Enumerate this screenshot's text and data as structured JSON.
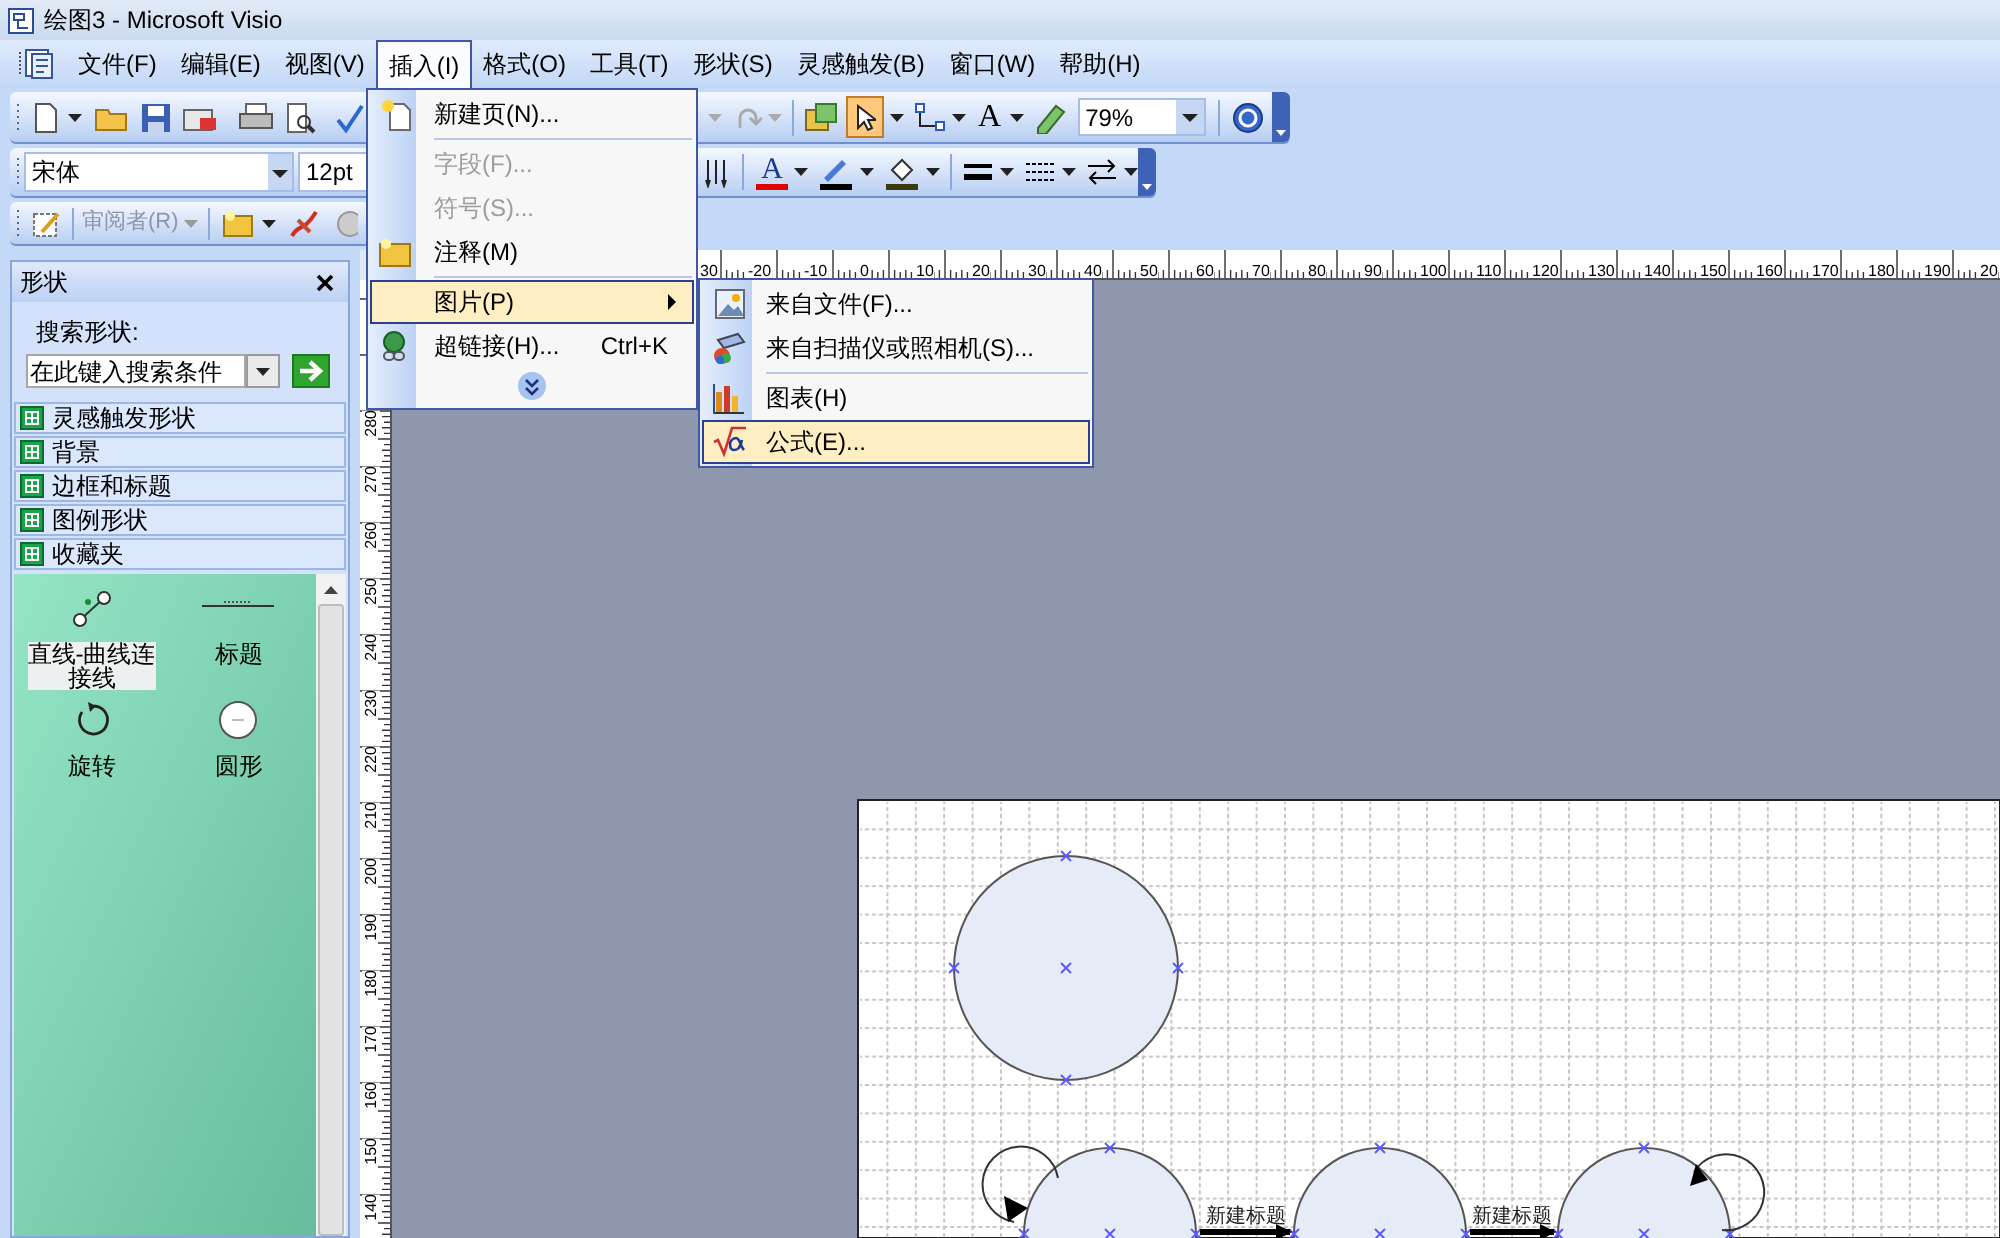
{
  "window": {
    "title": "绘图3 - Microsoft Visio"
  },
  "menu_bar": [
    {
      "label": "文件(F)",
      "selected": false
    },
    {
      "label": "编辑(E)",
      "selected": false
    },
    {
      "label": "视图(V)",
      "selected": false
    },
    {
      "label": "插入(I)",
      "selected": true
    },
    {
      "label": "格式(O)",
      "selected": false
    },
    {
      "label": "工具(T)",
      "selected": false
    },
    {
      "label": "形状(S)",
      "selected": false
    },
    {
      "label": "灵感触发(B)",
      "selected": false
    },
    {
      "label": "窗口(W)",
      "selected": false
    },
    {
      "label": "帮助(H)",
      "selected": false
    }
  ],
  "standard_toolbar": {
    "text_tool": "A",
    "zoom": "79%"
  },
  "formatting_toolbar": {
    "font": "宋体",
    "font_size": "12pt",
    "font_color_tool": "A"
  },
  "reviewing_toolbar": {
    "reviewer": {
      "label": "审阅者(R)",
      "disabled": true
    }
  },
  "insert_menu": [
    {
      "kind": "item",
      "label": "新建页(N)...",
      "disabled": false,
      "selected": false
    },
    {
      "kind": "separator"
    },
    {
      "kind": "item",
      "label": "字段(F)...",
      "disabled": true,
      "selected": false
    },
    {
      "kind": "item",
      "label": "符号(S)...",
      "disabled": true,
      "selected": false
    },
    {
      "kind": "item",
      "label": "注释(M)",
      "disabled": false,
      "selected": false
    },
    {
      "kind": "separator"
    },
    {
      "kind": "item",
      "label": "图片(P)",
      "disabled": false,
      "selected": true,
      "submenu": true
    },
    {
      "kind": "item",
      "label": "超链接(H)...",
      "shortcut": "Ctrl+K",
      "disabled": false,
      "selected": false
    },
    {
      "kind": "more"
    }
  ],
  "picture_submenu": [
    {
      "kind": "item",
      "label": "来自文件(F)...",
      "selected": false
    },
    {
      "kind": "item",
      "label": "来自扫描仪或照相机(S)...",
      "selected": false
    },
    {
      "kind": "separator"
    },
    {
      "kind": "item",
      "label": "图表(H)",
      "selected": false
    },
    {
      "kind": "item",
      "label": "公式(E)...",
      "selected": true
    }
  ],
  "shapes_panel": {
    "title": "形状",
    "search_label": "搜索形状:",
    "search": {
      "placeholder": "在此键入搜索条件"
    },
    "stencils": [
      {
        "label": "灵感触发形状"
      },
      {
        "label": "背景"
      },
      {
        "label": "边框和标题"
      },
      {
        "label": "图例形状"
      },
      {
        "label": "收藏夹"
      }
    ],
    "masters": [
      {
        "label": "直线-曲线连接线",
        "selected": true
      },
      {
        "label": "标题",
        "selected": false
      },
      {
        "label": "旋转",
        "selected": false
      },
      {
        "label": "圆形",
        "selected": false
      }
    ]
  },
  "rulers": {
    "horizontal": [
      "30",
      "-20",
      "-10",
      "0",
      "10",
      "20",
      "30",
      "40",
      "50",
      "60",
      "70",
      "80",
      "90",
      "100",
      "110",
      "120",
      "130",
      "140",
      "150",
      "160",
      "170",
      "180",
      "190",
      "20"
    ],
    "vertical": [
      "280",
      "270",
      "260",
      "250",
      "240",
      "230",
      "220",
      "210",
      "200",
      "190",
      "180",
      "170",
      "160",
      "150",
      "140"
    ]
  },
  "drawing": {
    "connector_labels": [
      "新建标题",
      "新建标题"
    ]
  }
}
